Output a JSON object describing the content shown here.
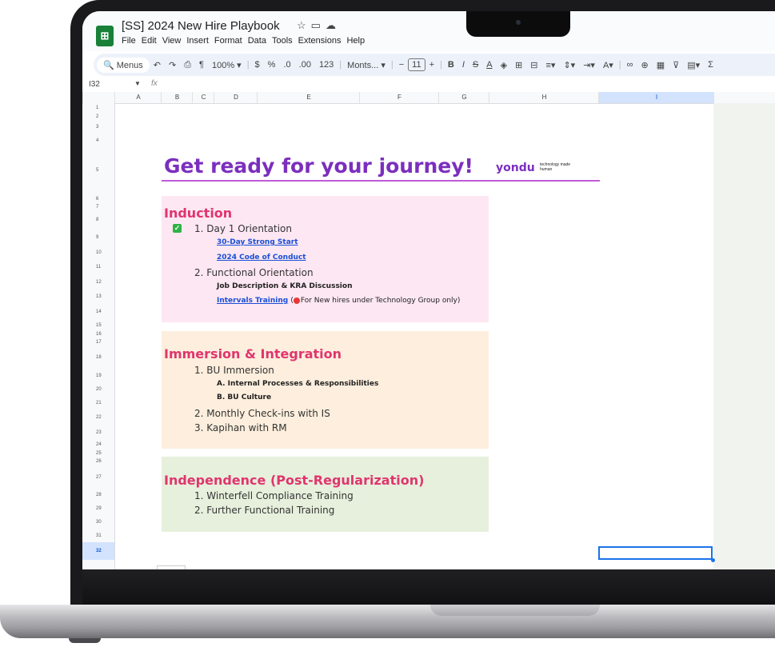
{
  "window": {
    "title": "[SS] 2024 New Hire Playbook",
    "menu": [
      "File",
      "Edit",
      "View",
      "Insert",
      "Format",
      "Data",
      "Tools",
      "Extensions",
      "Help"
    ]
  },
  "toolbar": {
    "menus_label": "Menus",
    "zoom": "100%",
    "currency": "$",
    "percent": "%",
    "dec_decrease": ".0",
    "dec_increase": ".00",
    "number_format": "123",
    "font": "Monts...",
    "font_size": "11",
    "bold": "B",
    "italic": "I",
    "strike": "S",
    "text_color": "A",
    "sum": "Σ"
  },
  "formula_bar": {
    "cell_ref": "I32",
    "fx": "fx"
  },
  "columns": [
    "A",
    "B",
    "C",
    "D",
    "E",
    "F",
    "G",
    "H",
    "I"
  ],
  "rows": [
    "1",
    "2",
    "3",
    "4",
    "5",
    "6",
    "7",
    "8",
    "9",
    "10",
    "11",
    "12",
    "13",
    "14",
    "15",
    "16",
    "17",
    "18",
    "19",
    "20",
    "21",
    "22",
    "23",
    "24",
    "25",
    "26",
    "27",
    "28",
    "29",
    "30",
    "31",
    "32"
  ],
  "sheet": {
    "heading": "Get ready for your journey!",
    "brand": "yondu",
    "tagline": "technology made human",
    "sections": {
      "induction": {
        "title": "Induction",
        "item1": "1. Day 1 Orientation",
        "link1": "30-Day Strong Start",
        "link2": "2024 Code of Conduct",
        "item2": "2. Functional Orientation",
        "sub1": "Job Description & KRA Discussion",
        "link3": "Intervals Training",
        "note_open": "(",
        "note": "For New hires under Technology Group only)"
      },
      "immersion": {
        "title": "Immersion & Integration",
        "item1": "1. BU Immersion",
        "sub1": "A. Internal Processes & Responsibilities",
        "sub2": "B. BU Culture",
        "item2": "2. Monthly Check-ins with IS",
        "item3": "3. Kapihan with RM"
      },
      "independence": {
        "title": "Independence (Post-Regularization)",
        "item1": "1. Winterfell Compliance Training",
        "item2": "2. Further Functional Training"
      }
    }
  },
  "colors": {
    "heading": "#7b2fbe",
    "section_title": "#e0356e",
    "induction_bg": "#fde7f2",
    "immersion_bg": "#fdeedd",
    "independence_bg": "#e6f0dc",
    "link": "#1a4fd6"
  }
}
